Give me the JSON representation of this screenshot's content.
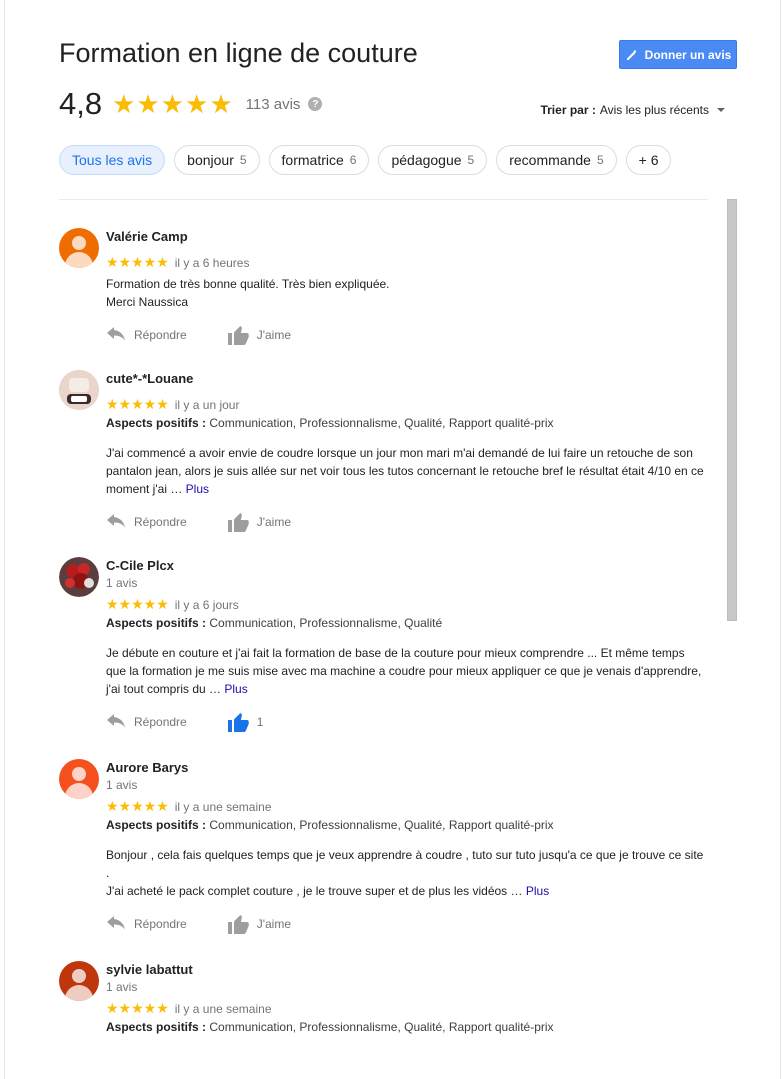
{
  "header": {
    "title": "Formation en ligne de couture",
    "review_button": "Donner un avis",
    "rating": "4,8",
    "stars": "★★★★★",
    "review_count": "113 avis",
    "help": "?",
    "sort_label": "Trier par :",
    "sort_value": "Avis les plus récents"
  },
  "colors": {
    "star": "#fbbc04",
    "accent": "#4a8af4",
    "link": "#1a0dab",
    "liked": "#1a73e8"
  },
  "chips": [
    {
      "label": "Tous les avis",
      "count": ""
    },
    {
      "label": "bonjour",
      "count": "5"
    },
    {
      "label": "formatrice",
      "count": "6"
    },
    {
      "label": "pédagogue",
      "count": "5"
    },
    {
      "label": "recommande",
      "count": "5"
    },
    {
      "label": "+ 6",
      "count": ""
    }
  ],
  "reviews": [
    {
      "name": "Valérie Camp",
      "subcount": "",
      "stars": "★★★★★",
      "time": "il y a 6 heures",
      "aspects_label": "",
      "aspects": "",
      "text": "Formation de très bonne qualité. Très bien expliquée.\nMerci Naussica",
      "more": "",
      "reply": "Répondre",
      "like": "J'aime",
      "avatar_color": "#ef6c00"
    },
    {
      "name": "cute*-*Louane",
      "subcount": "",
      "stars": "★★★★★",
      "time": "il y a un jour",
      "aspects_label": "Aspects positifs :",
      "aspects": "Communication, Professionnalisme, Qualité, Rapport qualité-prix",
      "text": "J'ai commencé a avoir envie de coudre lorsque un jour mon mari m'ai demandé de lui faire un retouche de son pantalon jean, alors je suis allée sur net voir tous les tutos concernant le retouche bref le résultat était 4/10 en ce moment j'ai … ",
      "more": "Plus",
      "reply": "Répondre",
      "like": "J'aime",
      "avatar_color": "#d9c2b5"
    },
    {
      "name": "C-Cile Plcx",
      "subcount": "1 avis",
      "stars": "★★★★★",
      "time": "il y a 6 jours",
      "aspects_label": "Aspects positifs :",
      "aspects": "Communication, Professionnalisme, Qualité",
      "text": "Je débute en couture et j'ai fait la formation de base de la couture pour mieux comprendre ... Et même temps que la formation je me suis mise avec ma machine a  coudre pour mieux appliquer ce que je venais d'apprendre, j'ai tout compris du … ",
      "more": "Plus",
      "reply": "Répondre",
      "like": "1",
      "avatar_color": "#7a2a2a"
    },
    {
      "name": "Aurore Barys",
      "subcount": "1 avis",
      "stars": "★★★★★",
      "time": "il y a une semaine",
      "aspects_label": "Aspects positifs :",
      "aspects": "Communication, Professionnalisme, Qualité, Rapport qualité-prix",
      "text": "Bonjour , cela  fais quelques temps que je veux apprendre à coudre , tuto sur tuto jusqu'a ce que je trouve ce site .\nJ'ai acheté  le pack complet couture  , je le trouve super et de plus les vidéos … ",
      "more": "Plus",
      "reply": "Répondre",
      "like": "J'aime",
      "avatar_color": "#f4511e"
    },
    {
      "name": "sylvie labattut",
      "subcount": "1 avis",
      "stars": "★★★★★",
      "time": "il y a une semaine",
      "aspects_label": "Aspects positifs :",
      "aspects": "Communication, Professionnalisme, Qualité, Rapport qualité-prix",
      "text": "",
      "more": "",
      "reply": "",
      "like": "",
      "avatar_color": "#bf360c"
    }
  ]
}
